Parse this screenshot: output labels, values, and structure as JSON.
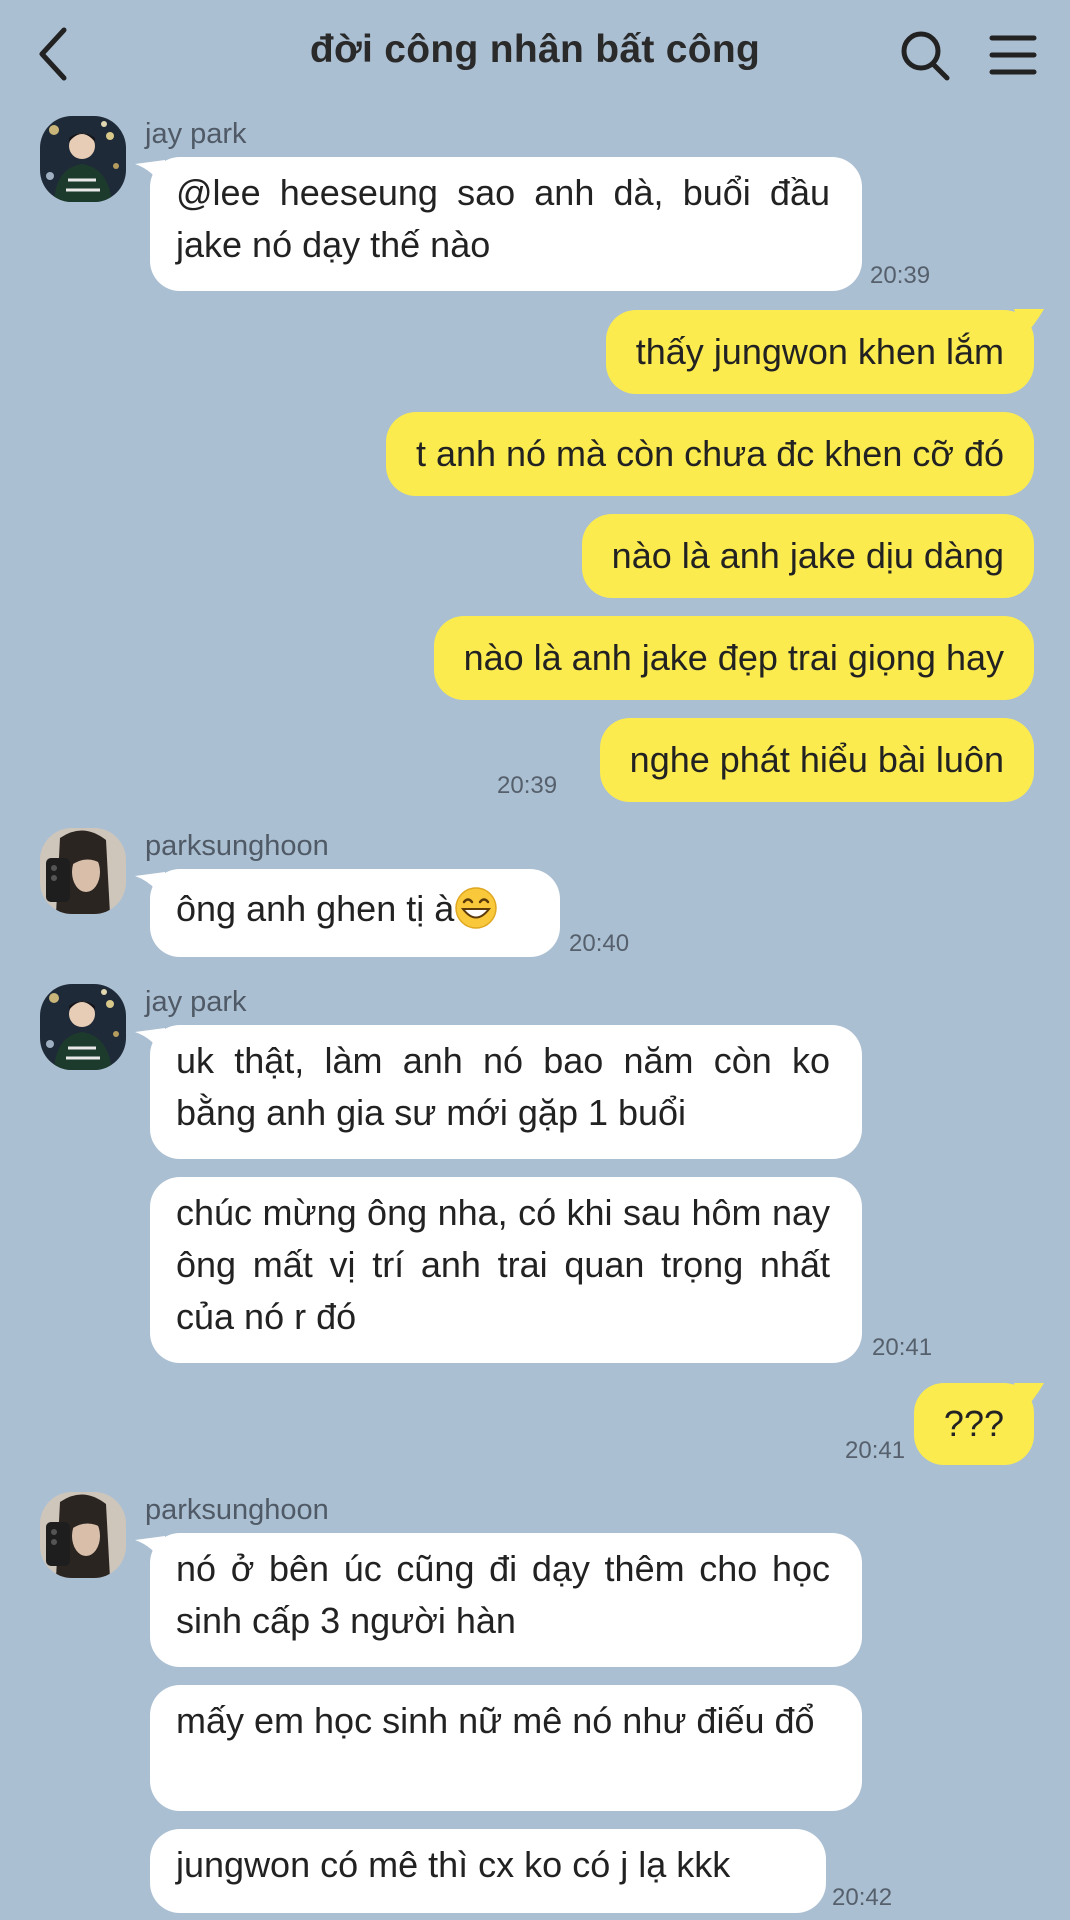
{
  "header": {
    "title": "đời công nhân bất công"
  },
  "messages": [
    {
      "sender": "jay park",
      "text": "@lee heeseung sao anh dà, buổi đầu jake nó dạy thế nào",
      "time": "20:39"
    },
    {
      "text": "thấy jungwon khen lắm"
    },
    {
      "text": "t anh nó mà còn chưa đc khen cỡ đó"
    },
    {
      "text": "nào là anh jake dịu dàng"
    },
    {
      "text": "nào là anh jake đẹp trai giọng hay"
    },
    {
      "text": "nghe phát hiểu bài luôn",
      "time": "20:39"
    },
    {
      "sender": "parksunghoon",
      "text": "ông anh ghen tị à",
      "time": "20:40"
    },
    {
      "sender": "jay park",
      "text": "uk thật, làm anh nó bao năm còn ko bằng anh gia sư mới gặp 1 buổi"
    },
    {
      "text": "chúc mừng ông nha, có khi sau hôm nay ông mất vị trí anh trai quan trọng nhất của nó r đó",
      "time": "20:41"
    },
    {
      "text": "???",
      "time": "20:41"
    },
    {
      "sender": "parksunghoon",
      "text": "nó ở bên úc cũng đi dạy thêm cho học sinh cấp 3 người hàn"
    },
    {
      "text": "mấy em học sinh nữ mê nó như điếu đổ"
    },
    {
      "text": "jungwon có mê thì cx ko có j lạ kkk",
      "time": "20:42"
    }
  ],
  "icons": {
    "back": "chevron-left-icon",
    "search": "search-icon",
    "menu": "hamburger-menu-icon",
    "emoji": "grinning-face-icon"
  },
  "colors": {
    "background": "#abbfd2",
    "incoming_bubble": "#ffffff",
    "outgoing_bubble": "#fbeb4f"
  }
}
